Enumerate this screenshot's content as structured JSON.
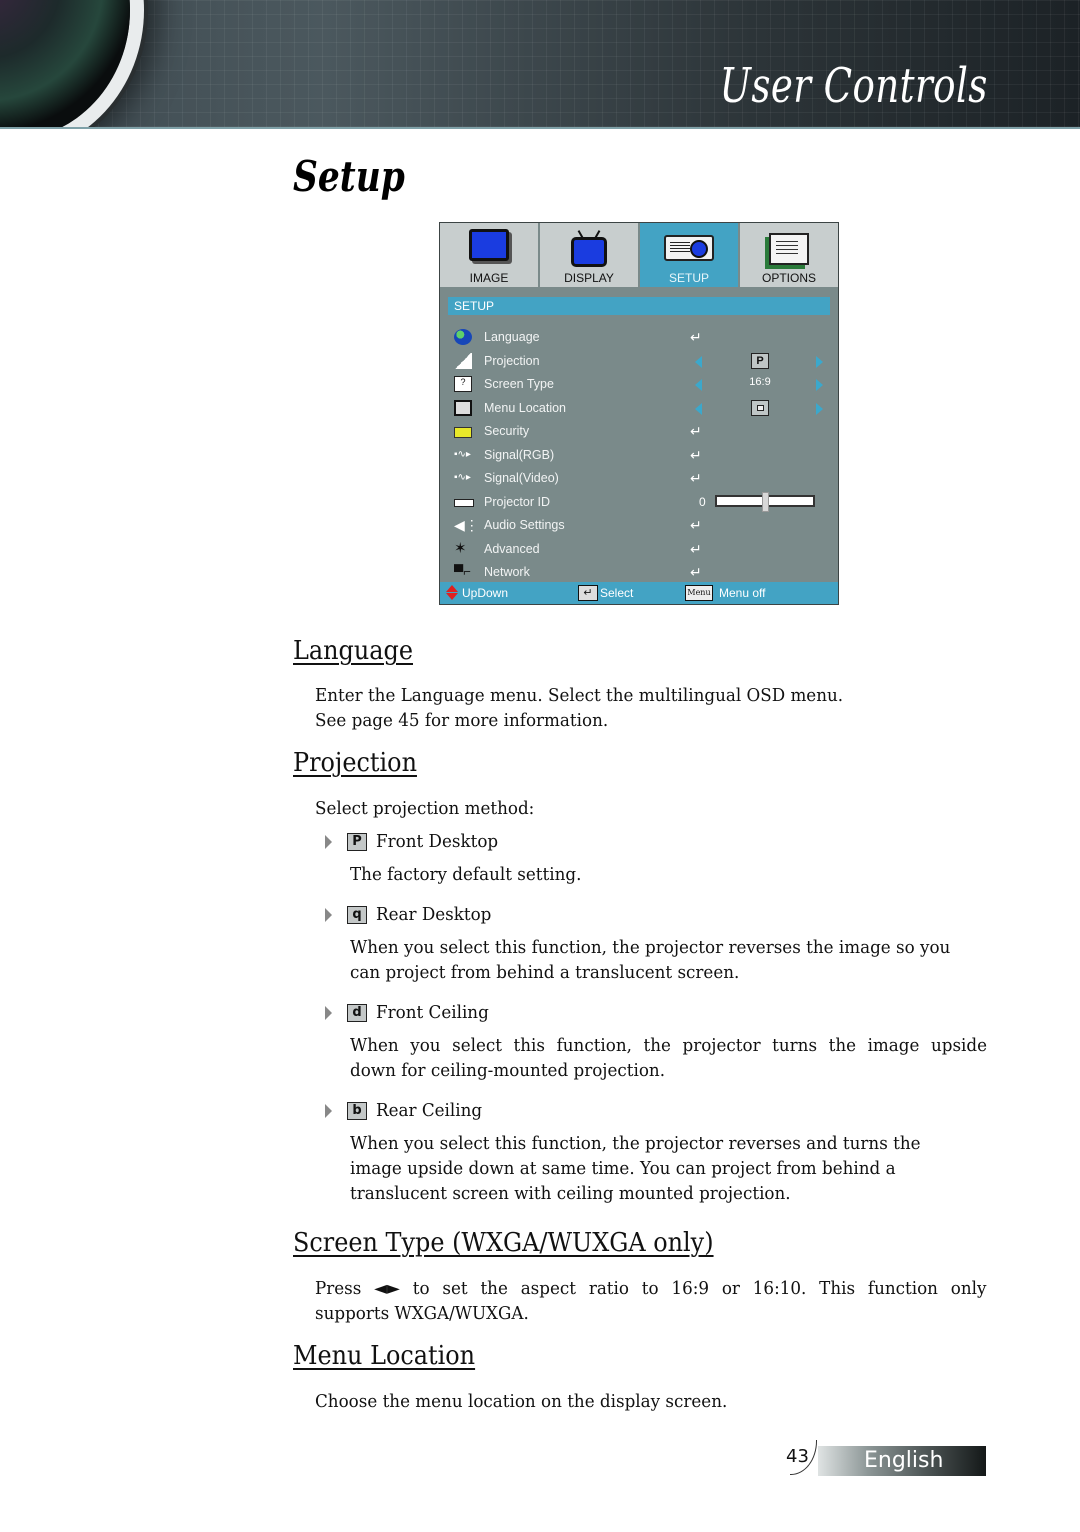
{
  "header": {
    "section_title": "User Controls"
  },
  "page_title": "Setup",
  "osd": {
    "tabs": [
      {
        "label": "IMAGE",
        "icon": "monitor-icon",
        "active": false
      },
      {
        "label": "DISPLAY",
        "icon": "tv-icon",
        "active": false
      },
      {
        "label": "SETUP",
        "icon": "projector-icon",
        "active": true
      },
      {
        "label": "OPTIONS",
        "icon": "notepad-icon",
        "active": false
      }
    ],
    "section_label": "SETUP",
    "items": [
      {
        "label": "Language",
        "icon": "globe-icon",
        "control": "enter",
        "enter_glyph": "↵"
      },
      {
        "label": "Projection",
        "icon": "projection-icon",
        "control": "select",
        "value": "P"
      },
      {
        "label": "Screen Type",
        "icon": "screen-icon",
        "control": "select",
        "value": "16:9"
      },
      {
        "label": "Menu Location",
        "icon": "document-icon",
        "control": "select",
        "value": "center"
      },
      {
        "label": "Security",
        "icon": "lock-icon",
        "control": "enter",
        "enter_glyph": "↵"
      },
      {
        "label": "Signal(RGB)",
        "icon": "signal-icon",
        "control": "enter",
        "enter_glyph": "↵"
      },
      {
        "label": "Signal(Video)",
        "icon": "signal-icon",
        "control": "enter",
        "enter_glyph": "↵"
      },
      {
        "label": "Projector ID",
        "icon": "projector-id-icon",
        "control": "slider",
        "value": "0",
        "slider_fraction": 0.5
      },
      {
        "label": "Audio Settings",
        "icon": "speaker-icon",
        "control": "enter",
        "enter_glyph": "↵"
      },
      {
        "label": "Advanced",
        "icon": "star-icon",
        "control": "enter",
        "enter_glyph": "↵"
      },
      {
        "label": "Network",
        "icon": "network-icon",
        "control": "enter",
        "enter_glyph": "↵"
      }
    ],
    "footer": {
      "updown_label": "UpDown",
      "select_label": "Select",
      "menu_key": "Menu",
      "menu_off_label": "Menu off"
    },
    "colors": {
      "accent": "#43a3c4",
      "panel": "#7a8a8a",
      "tab_inactive": "#c8cece"
    }
  },
  "sections": {
    "language": {
      "heading": "Language",
      "text_line1": "Enter the Language menu. Select the multilingual OSD menu.",
      "text_line2": "See page 45 for more information."
    },
    "projection": {
      "heading": "Projection",
      "intro": "Select projection method:",
      "options": [
        {
          "glyph": "P",
          "label": "Front Desktop",
          "description": "The factory default setting."
        },
        {
          "glyph": "q",
          "label": "Rear Desktop",
          "description_line1": "When you select this function, the projector reverses the image so you",
          "description_line2": "can project from behind a translucent screen."
        },
        {
          "glyph": "d",
          "label": "Front Ceiling",
          "description_line1": "When you select this function, the projector turns the image upside",
          "description_line2": "down for ceiling-mounted projection."
        },
        {
          "glyph": "b",
          "label": "Rear Ceiling",
          "description_line1": "When you select this function, the projector reverses and turns the",
          "description_line2": "image upside down at same time. You can project from behind a",
          "description_line3": "translucent screen with ceiling mounted projection."
        }
      ]
    },
    "screen_type": {
      "heading": "Screen Type (WXGA/WUXGA only)",
      "text_line1": "Press ◄► to set the aspect ratio to 16:9 or 16:10. This function only",
      "text_line2": "supports WXGA/WUXGA."
    },
    "menu_location": {
      "heading": "Menu Location",
      "text": "Choose the menu location on the display screen."
    }
  },
  "footer": {
    "page_number": "43",
    "language": "English"
  }
}
